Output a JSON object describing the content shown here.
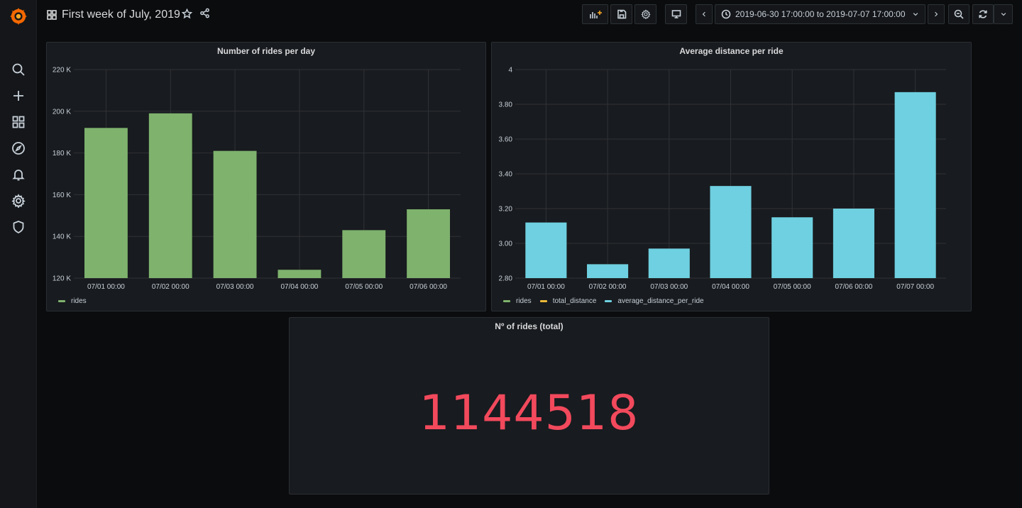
{
  "app": {
    "logo_icon": "grafana-logo-icon"
  },
  "sidebar": {
    "items": [
      {
        "icon": "search-icon",
        "label": "Search"
      },
      {
        "icon": "plus-icon",
        "label": "Create"
      },
      {
        "icon": "dashboards-icon",
        "label": "Dashboards"
      },
      {
        "icon": "compass-icon",
        "label": "Explore"
      },
      {
        "icon": "bell-icon",
        "label": "Alerting"
      },
      {
        "icon": "gear-icon",
        "label": "Configuration"
      },
      {
        "icon": "shield-icon",
        "label": "Server Admin"
      }
    ]
  },
  "header": {
    "title": "First week of July, 2019",
    "time_range": "2019-06-30 17:00:00 to 2019-07-07 17:00:00"
  },
  "panels": {
    "rides_per_day": {
      "title": "Number of rides per day",
      "legend": [
        {
          "name": "rides",
          "color": "#7eb26d"
        }
      ]
    },
    "avg_distance": {
      "title": "Average distance per ride",
      "legend": [
        {
          "name": "rides",
          "color": "#7eb26d"
        },
        {
          "name": "total_distance",
          "color": "#eab839"
        },
        {
          "name": "average_distance_per_ride",
          "color": "#6ed0e0"
        }
      ]
    },
    "total_rides": {
      "title": "Nº of rides (total)",
      "value": "1144518",
      "color": "#f2495c"
    }
  },
  "chart_data": [
    {
      "type": "bar",
      "title": "Number of rides per day",
      "categories": [
        "07/01 00:00",
        "07/02 00:00",
        "07/03 00:00",
        "07/04 00:00",
        "07/05 00:00",
        "07/06 00:00"
      ],
      "series": [
        {
          "name": "rides",
          "values": [
            192000,
            199000,
            181000,
            124000,
            143000,
            153000
          ],
          "color": "#7eb26d"
        }
      ],
      "ylim": [
        120000,
        220000
      ],
      "yticks": [
        "120 K",
        "140 K",
        "160 K",
        "180 K",
        "200 K",
        "220 K"
      ],
      "ytick_values": [
        120000,
        140000,
        160000,
        180000,
        200000,
        220000
      ],
      "grid": true,
      "legend": "bottom-left"
    },
    {
      "type": "bar",
      "title": "Average distance per ride",
      "categories": [
        "07/01 00:00",
        "07/02 00:00",
        "07/03 00:00",
        "07/04 00:00",
        "07/05 00:00",
        "07/06 00:00",
        "07/07 00:00"
      ],
      "series": [
        {
          "name": "average_distance_per_ride",
          "values": [
            3.12,
            2.88,
            2.97,
            3.33,
            3.15,
            3.2,
            3.87
          ],
          "color": "#6ed0e0"
        }
      ],
      "ylim": [
        2.8,
        4.0
      ],
      "yticks": [
        "2.80",
        "3.00",
        "3.20",
        "3.40",
        "3.60",
        "3.80",
        "4"
      ],
      "ytick_values": [
        2.8,
        3.0,
        3.2,
        3.4,
        3.6,
        3.8,
        4.0
      ],
      "grid": true,
      "legend": "bottom-left"
    }
  ]
}
